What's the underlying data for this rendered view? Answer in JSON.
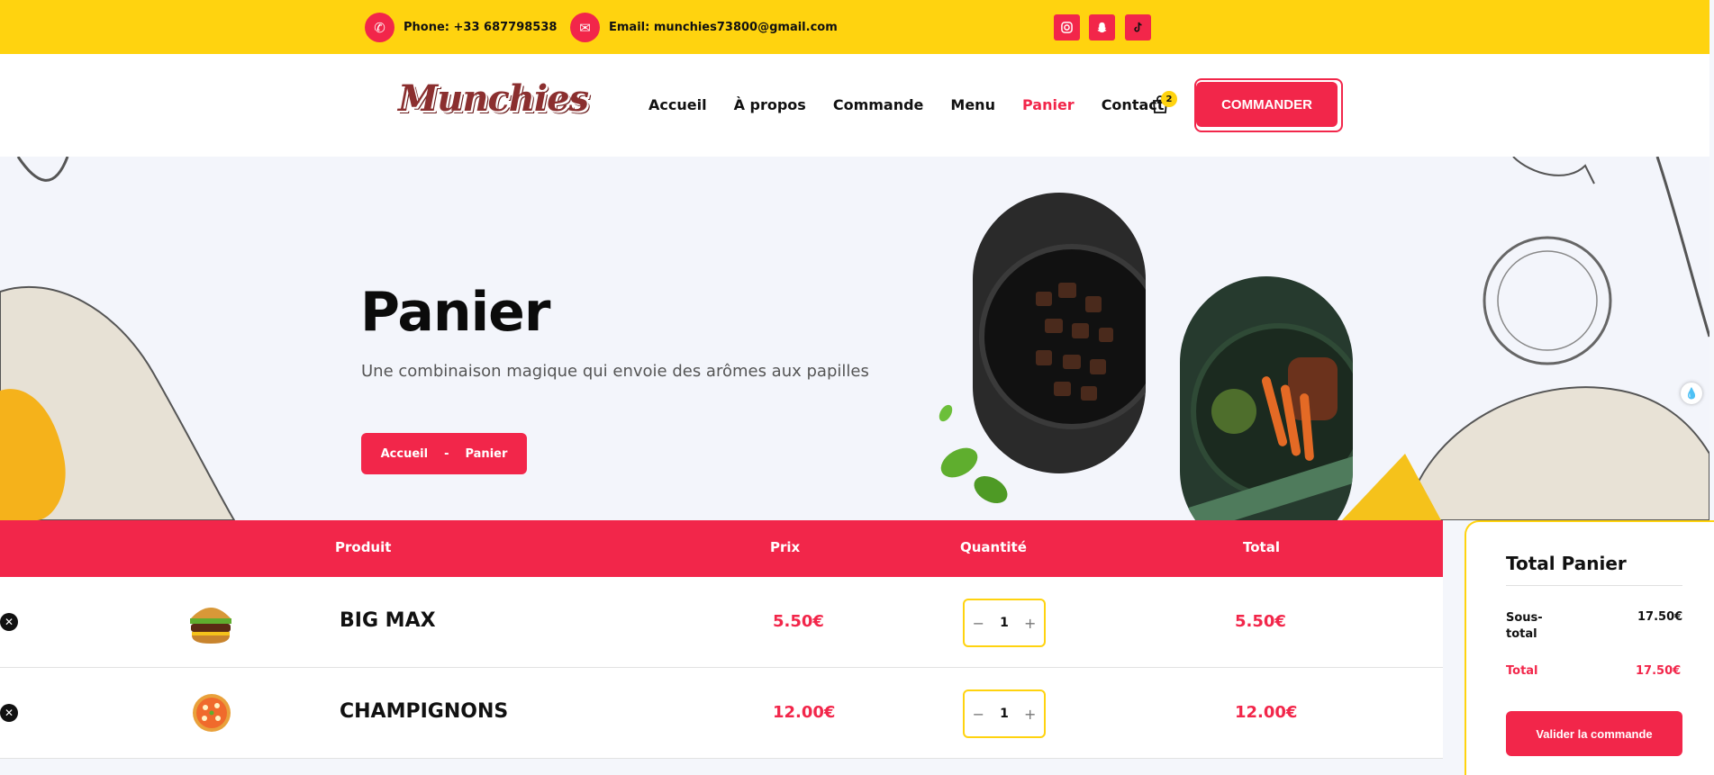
{
  "topbar": {
    "phone": "Phone: +33 687798538",
    "email": "Email: munchies73800@gmail.com",
    "socials": [
      "instagram-icon",
      "snapchat-icon",
      "tiktok-icon"
    ]
  },
  "header": {
    "logo": "Munchies",
    "nav": [
      "Accueil",
      "À propos",
      "Commande",
      "Menu",
      "Panier",
      "Contact"
    ],
    "active_nav": "Panier",
    "cart_count": "2",
    "cta": "COMMANDER"
  },
  "hero": {
    "title": "Panier",
    "subtitle": "Une combinaison magique qui envoie des arômes aux papilles",
    "breadcrumb": [
      "Accueil",
      "-",
      "Panier"
    ]
  },
  "table": {
    "headers": [
      "Produit",
      "Prix",
      "Quantité",
      "Total"
    ],
    "rows": [
      {
        "name": "BIG MAX",
        "price": "5.50€",
        "qty": "1",
        "total": "5.50€",
        "icon": "burger-icon"
      },
      {
        "name": "CHAMPIGNONS",
        "price": "12.00€",
        "qty": "1",
        "total": "12.00€",
        "icon": "pizza-icon"
      }
    ]
  },
  "totals": {
    "title": "Total Panier",
    "subtotal_label": "Sous-total",
    "subtotal_value": "17.50€",
    "total_label": "Total",
    "total_value": "17.50€",
    "validate": "Valider la commande"
  },
  "colors": {
    "accent": "#f2264a",
    "yellow": "#ffd30f"
  }
}
